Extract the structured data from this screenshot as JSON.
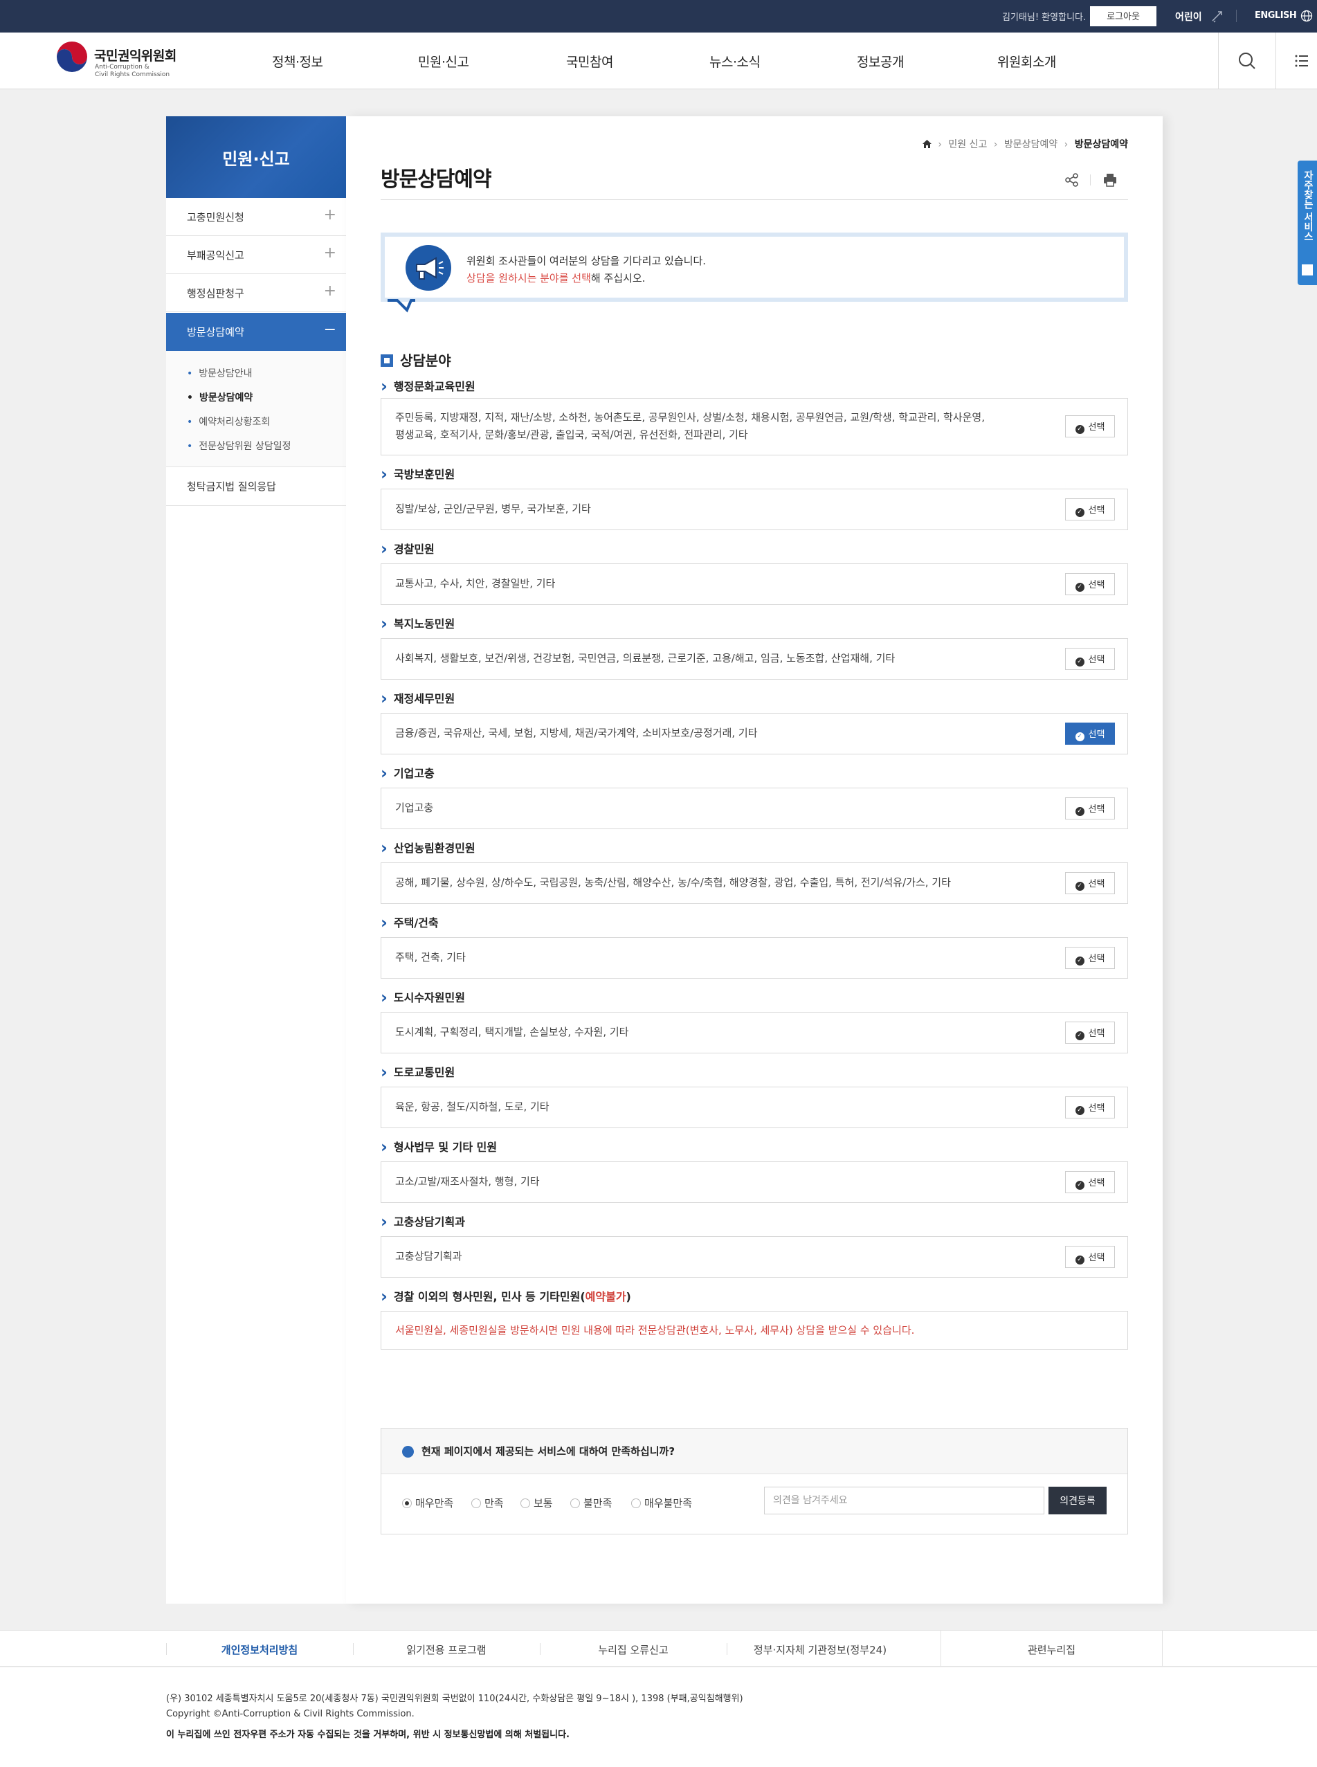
{
  "topbar": {
    "welcome": "김기태님! 환영합니다.",
    "logout": "로그아웃",
    "kids": "어린이",
    "english": "ENGLISH"
  },
  "header": {
    "logo_ko": "국민권익위원회",
    "logo_en1": "Anti-Corruption &",
    "logo_en2": "Civil Rights Commission",
    "nav": [
      "정책·정보",
      "민원·신고",
      "국민참여",
      "뉴스·소식",
      "정보공개",
      "위원회소개"
    ]
  },
  "sidetab": {
    "label": "자주찾는 서비스"
  },
  "lnb": {
    "title": "민원·신고",
    "items": [
      "고충민원신청",
      "부패공익신고",
      "행정심판청구",
      "방문상담예약",
      "청탁금지법 질의응답"
    ],
    "toggles": [
      "+",
      "+",
      "+",
      "−"
    ],
    "sub": [
      "방문상담안내",
      "방문상담예약",
      "예약처리상황조회",
      "전문상담위원 상담일정"
    ]
  },
  "breadcrumb": {
    "items": [
      "민원 신고",
      "방문상담예약"
    ],
    "current": "방문상담예약"
  },
  "page": {
    "title": "방문상담예약"
  },
  "notice": {
    "line1": "위원회 조사관들이 여러분의 상담을 기다리고 있습니다.",
    "line2_red": "상담을 원하시는 분야를 선택",
    "line2_rest": "해 주십시오."
  },
  "section": {
    "title": "상담분야"
  },
  "select_label": "선택",
  "categories": [
    {
      "title": "행정문화교육민원",
      "desc1": "주민등록, 지방재정, 지적, 재난/소방, 소하천, 농어촌도로, 공무원인사, 상벌/소청, 채용시험, 공무원연금, 교원/학생, 학교관리, 학사운영,",
      "desc2": "평생교육, 호적기사, 문화/홍보/관광, 출입국, 국적/여권, 유선전화, 전파관리, 기타"
    },
    {
      "title": "국방보훈민원",
      "desc1": "징발/보상, 군인/군무원, 병무, 국가보훈, 기타"
    },
    {
      "title": "경찰민원",
      "desc1": "교통사고, 수사, 치안, 경찰일반, 기타"
    },
    {
      "title": "복지노동민원",
      "desc1": "사회복지, 생활보호, 보건/위생, 건강보험, 국민연금, 의료분쟁, 근로기준, 고용/해고, 임금, 노동조합, 산업재해, 기타"
    },
    {
      "title": "재정세무민원",
      "desc1": "금융/증권, 국유재산, 국세, 보험, 지방세, 채권/국가계약, 소비자보호/공정거래, 기타"
    },
    {
      "title": "기업고충",
      "desc1": "기업고충"
    },
    {
      "title": "산업농림환경민원",
      "desc1": "공해, 폐기물, 상수원, 상/하수도, 국립공원, 농축/산림, 해양수산, 농/수/축협, 해양경찰, 광업, 수출입, 특허, 전기/석유/가스, 기타"
    },
    {
      "title": "주택/건축",
      "desc1": "주택, 건축, 기타"
    },
    {
      "title": "도시수자원민원",
      "desc1": "도시계획, 구획정리, 택지개발, 손실보상, 수자원, 기타"
    },
    {
      "title": "도로교통민원",
      "desc1": "육운, 항공, 철도/지하철, 도로, 기타"
    },
    {
      "title": "형사법무 및 기타 민원",
      "desc1": "고소/고발/재조사절차, 행형, 기타"
    },
    {
      "title": "고충상담기획과",
      "desc1": "고충상담기획과"
    }
  ],
  "last_category": {
    "title": "경찰 이외의 형사민원, 민사 등 기타민원(",
    "title_red": "예약불가",
    "title_end": ")",
    "desc": "서울민원실, 세종민원실을 방문하시면 민원 내용에 따라 전문상담관(변호사, 노무사, 세무사) 상담을 받으실 수 있습니다."
  },
  "survey": {
    "question": "현재 페이지에서 제공되는 서비스에 대하여 만족하십니까?",
    "options": [
      "매우만족",
      "만족",
      "보통",
      "불만족",
      "매우불만족"
    ],
    "placeholder": "의견을 남겨주세요",
    "submit": "의견등록"
  },
  "footer": {
    "links": [
      "개인정보처리방침",
      "읽기전용 프로그램",
      "누리집 오류신고",
      "정부·지자체 기관정보(정부24)"
    ],
    "related": "관련누리집",
    "address": "(우) 30102 세종특별자치시 도움5로 20(세종청사 7동) 국민권익위원회     국번없이 110(24시간, 수화상담은 평일 9~18시 ), 1398 (부패,공익침해행위)",
    "copyright": "Copyright ©Anti-Corruption & Civil Rights Commission.",
    "law": "이 누리집에 쓰인 전자우편 주소가 자동 수집되는 것을 거부하며, 위반 시 정보통신망법에 의해 처벌됩니다."
  },
  "colors": {
    "primary": "#2e6bba",
    "topbar": "#273653",
    "warning": "#d0413a"
  }
}
